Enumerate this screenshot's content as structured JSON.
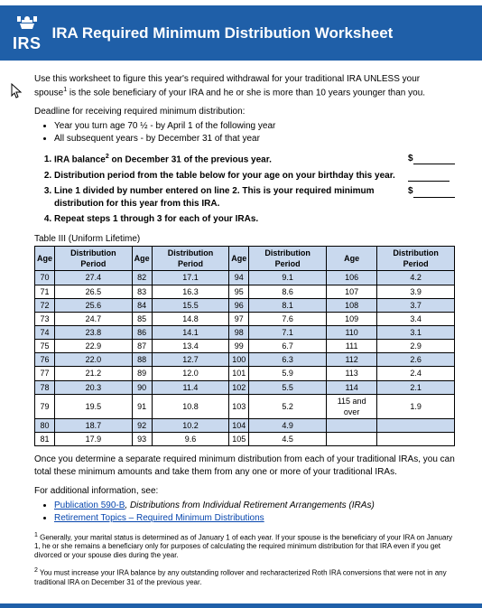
{
  "header": {
    "org": "IRS",
    "title": "IRA Required Minimum Distribution Worksheet"
  },
  "intro": {
    "text1": "Use this worksheet to figure this year's required withdrawal for your traditional IRA UNLESS your spouse",
    "text2": " is the sole beneficiary of your IRA and he or she is more than 10 years younger than you.",
    "deadline_label": "Deadline for receiving required minimum distribution:",
    "deadline_bullets": [
      "Year you turn age 70 ½ - by April 1 of the following year",
      "All subsequent years - by December 31 of that year"
    ]
  },
  "steps": [
    {
      "pre": "IRA balance",
      "post": " on December 31 of the previous year.",
      "has_dollar": true
    },
    {
      "pre": "Distribution period from the table below for your age on your birthday this year.",
      "post": "",
      "has_dollar": false
    },
    {
      "pre": "Line 1 divided by number entered on line 2. This is your required minimum distribution for this year from this IRA.",
      "post": "",
      "has_dollar": true
    },
    {
      "pre": "Repeat steps 1 through 3 for each of your IRAs.",
      "post": "",
      "has_dollar": null
    }
  ],
  "table": {
    "caption": "Table III (Uniform Lifetime)",
    "headers": [
      "Age",
      "Distribution Period",
      "Age",
      "Distribution Period",
      "Age",
      "Distribution Period",
      "Age",
      "Distribution Period"
    ],
    "rows": [
      {
        "shade": true,
        "c": [
          "70",
          "27.4",
          "82",
          "17.1",
          "94",
          "9.1",
          "106",
          "4.2"
        ]
      },
      {
        "shade": false,
        "c": [
          "71",
          "26.5",
          "83",
          "16.3",
          "95",
          "8.6",
          "107",
          "3.9"
        ]
      },
      {
        "shade": true,
        "c": [
          "72",
          "25.6",
          "84",
          "15.5",
          "96",
          "8.1",
          "108",
          "3.7"
        ]
      },
      {
        "shade": false,
        "c": [
          "73",
          "24.7",
          "85",
          "14.8",
          "97",
          "7.6",
          "109",
          "3.4"
        ]
      },
      {
        "shade": true,
        "c": [
          "74",
          "23.8",
          "86",
          "14.1",
          "98",
          "7.1",
          "110",
          "3.1"
        ]
      },
      {
        "shade": false,
        "c": [
          "75",
          "22.9",
          "87",
          "13.4",
          "99",
          "6.7",
          "111",
          "2.9"
        ]
      },
      {
        "shade": true,
        "c": [
          "76",
          "22.0",
          "88",
          "12.7",
          "100",
          "6.3",
          "112",
          "2.6"
        ]
      },
      {
        "shade": false,
        "c": [
          "77",
          "21.2",
          "89",
          "12.0",
          "101",
          "5.9",
          "113",
          "2.4"
        ]
      },
      {
        "shade": true,
        "c": [
          "78",
          "20.3",
          "90",
          "11.4",
          "102",
          "5.5",
          "114",
          "2.1"
        ]
      },
      {
        "shade": false,
        "c": [
          "79",
          "19.5",
          "91",
          "10.8",
          "103",
          "5.2",
          "115 and over",
          "1.9"
        ]
      },
      {
        "shade": true,
        "c": [
          "80",
          "18.7",
          "92",
          "10.2",
          "104",
          "4.9",
          "",
          ""
        ]
      },
      {
        "shade": false,
        "c": [
          "81",
          "17.9",
          "93",
          "9.6",
          "105",
          "4.5",
          "",
          ""
        ]
      }
    ]
  },
  "after": {
    "para": "Once you determine a separate required minimum distribution from each of your traditional IRAs, you can total these minimum amounts and take them from any one or more of your traditional IRAs.",
    "see": "For additional information, see:",
    "links": [
      {
        "link": "Publication 590-B",
        "tail": ", Distributions from Individual Retirement Arrangements (IRAs)"
      },
      {
        "link": "Retirement Topics – Required Minimum Distributions",
        "tail": ""
      }
    ]
  },
  "footnotes": {
    "f1": "Generally, your marital status is determined as of January 1 of each year. If your spouse is the beneficiary of your IRA on January 1, he or she remains a beneficiary only for purposes of calculating the required minimum distribution for that IRA even if you get divorced or your spouse dies during the year.",
    "f2": "You must increase your IRA balance by any outstanding rollover and recharacterized Roth IRA conversions that were not in any traditional IRA on December 31 of the previous year."
  }
}
